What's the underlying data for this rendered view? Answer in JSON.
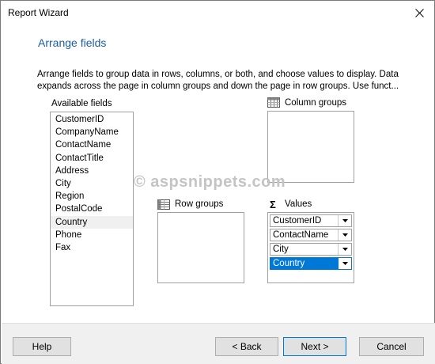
{
  "window": {
    "title": "Report Wizard",
    "close_icon": "close-icon"
  },
  "page": {
    "heading": "Arrange fields",
    "description": "Arrange fields to group data in rows, columns, or both, and choose values to display. Data expands across the page in column groups and down the page in row groups.  Use funct..."
  },
  "available_fields": {
    "label": "Available fields",
    "items": [
      "CustomerID",
      "CompanyName",
      "ContactName",
      "ContactTitle",
      "Address",
      "City",
      "Region",
      "PostalCode",
      "Country",
      "Phone",
      "Fax"
    ],
    "highlighted": "Country"
  },
  "column_groups": {
    "label": "Column groups",
    "icon": "grid-icon"
  },
  "row_groups": {
    "label": "Row groups",
    "icon": "grid-icon"
  },
  "values": {
    "label": "Values",
    "icon": "sigma-icon",
    "items": [
      "CustomerID",
      "ContactName",
      "City",
      "Country"
    ],
    "selected": "Country"
  },
  "watermark": "© aspsnippets.com",
  "buttons": {
    "help": "Help",
    "back": "< Back",
    "next": "Next >",
    "cancel": "Cancel"
  },
  "colors": {
    "heading": "#1b5ea6",
    "selection": "#0078d7",
    "footer": "#f0f0f0"
  }
}
